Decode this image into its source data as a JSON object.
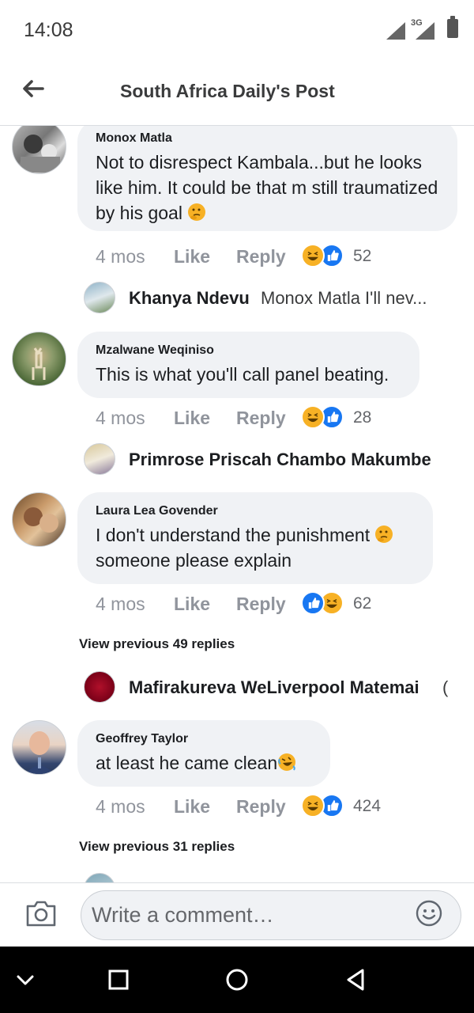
{
  "status_bar": {
    "time": "14:08",
    "network": "3G"
  },
  "header": {
    "title": "South Africa Daily's Post",
    "back_icon": "arrow-left-icon"
  },
  "comments": [
    {
      "author": "Monox Matla",
      "text": "Not to disrespect Kambala...but he looks like him. It could be that m still traumatized by his goal",
      "emoji": "thinking-face",
      "time": "4 mos",
      "like_label": "Like",
      "reply_label": "Reply",
      "reactions": [
        "haha",
        "like"
      ],
      "reaction_count": "52",
      "reply_preview": {
        "name": "Khanya Ndevu",
        "text": "Monox Matla I'll nev..."
      }
    },
    {
      "author": "Mzalwane Weqiniso",
      "text": "This is what you'll call panel beating.",
      "time": "4 mos",
      "like_label": "Like",
      "reply_label": "Reply",
      "reactions": [
        "haha",
        "like"
      ],
      "reaction_count": "28",
      "reply_preview": {
        "name": "Primrose Priscah Chambo Makumbe",
        "text": ""
      }
    },
    {
      "author": "Laura Lea Govender",
      "text": "I don't understand the punishment",
      "text_2": "someone please explain",
      "emoji": "thinking-face",
      "time": "4 mos",
      "like_label": "Like",
      "reply_label": "Reply",
      "reactions": [
        "like",
        "haha"
      ],
      "reaction_count": "62",
      "view_previous": "View previous 49 replies",
      "reply_preview": {
        "name": "Mafirakureva WeLiverpool Matemai",
        "text": "("
      }
    },
    {
      "author": "Geoffrey Taylor",
      "text": "at least he came clean",
      "emoji": "rolling-laughing",
      "time": "4 mos",
      "like_label": "Like",
      "reply_label": "Reply",
      "reactions": [
        "haha",
        "like"
      ],
      "reaction_count": "424",
      "view_previous": "View previous 31 replies"
    }
  ],
  "composer": {
    "placeholder": "Write a comment…",
    "camera_icon": "camera-icon",
    "emoji_icon": "smiley-icon"
  },
  "nav_bar": {
    "buttons": [
      "chevron-down-icon",
      "recents-square-icon",
      "home-circle-icon",
      "back-triangle-icon"
    ]
  },
  "colors": {
    "bubble": "#f0f2f5",
    "like_blue": "#1877f2",
    "haha_yellow": "#f7b125",
    "meta_gray": "#90949c"
  }
}
